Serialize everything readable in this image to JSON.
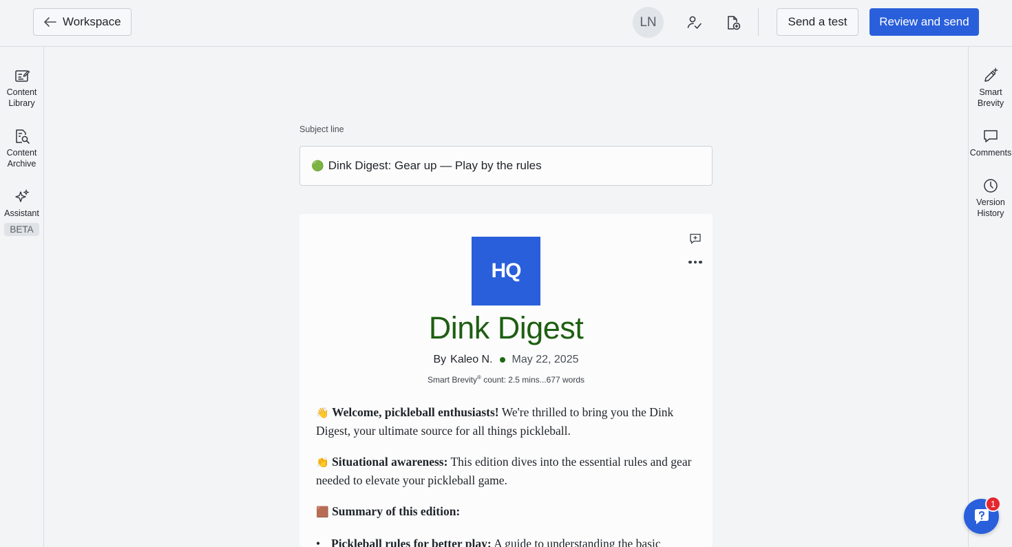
{
  "header": {
    "back_label": "Workspace",
    "avatar_initials": "LN",
    "send_test_label": "Send a test",
    "review_send_label": "Review and send"
  },
  "left_rail": {
    "content_library": "Content\nLibrary",
    "content_archive": "Content\nArchive",
    "assistant": "Assistant",
    "assistant_badge": "BETA"
  },
  "right_rail": {
    "smart_brevity": "Smart\nBrevity",
    "comments": "Comments",
    "version_history": "Version\nHistory"
  },
  "subject": {
    "label": "Subject line",
    "emoji": "🟢",
    "value": "Dink Digest: Gear up — Play by the rules"
  },
  "newsletter": {
    "logo_text": "HQ",
    "title": "Dink Digest",
    "by_prefix": "By",
    "author": "Kaleo N.",
    "date": "May 22, 2025",
    "brevity_prefix": "Smart Brevity",
    "brevity_mark": "®",
    "brevity_suffix": " count: 2.5 mins...677 words",
    "p1_emoji": "👋",
    "p1_bold": "Welcome, pickleball enthusiasts!",
    "p1_text": " We're thrilled to bring you the Dink Digest, your ultimate source for all things pickleball.",
    "p2_emoji": "👏",
    "p2_bold": "Situational awareness:",
    "p2_text": " This edition dives into the essential rules and gear needed to elevate your pickleball game.",
    "p3_emoji": "🟫",
    "p3_bold": "Summary of this edition:",
    "bullet1_bold": "Pickleball rules for better play:",
    "bullet1_text": " A guide to understanding the basic"
  },
  "help": {
    "badge_count": "1"
  },
  "colors": {
    "primary": "#2a5fdb",
    "title_green": "#1e5e12",
    "badge_red": "#e5262d"
  }
}
